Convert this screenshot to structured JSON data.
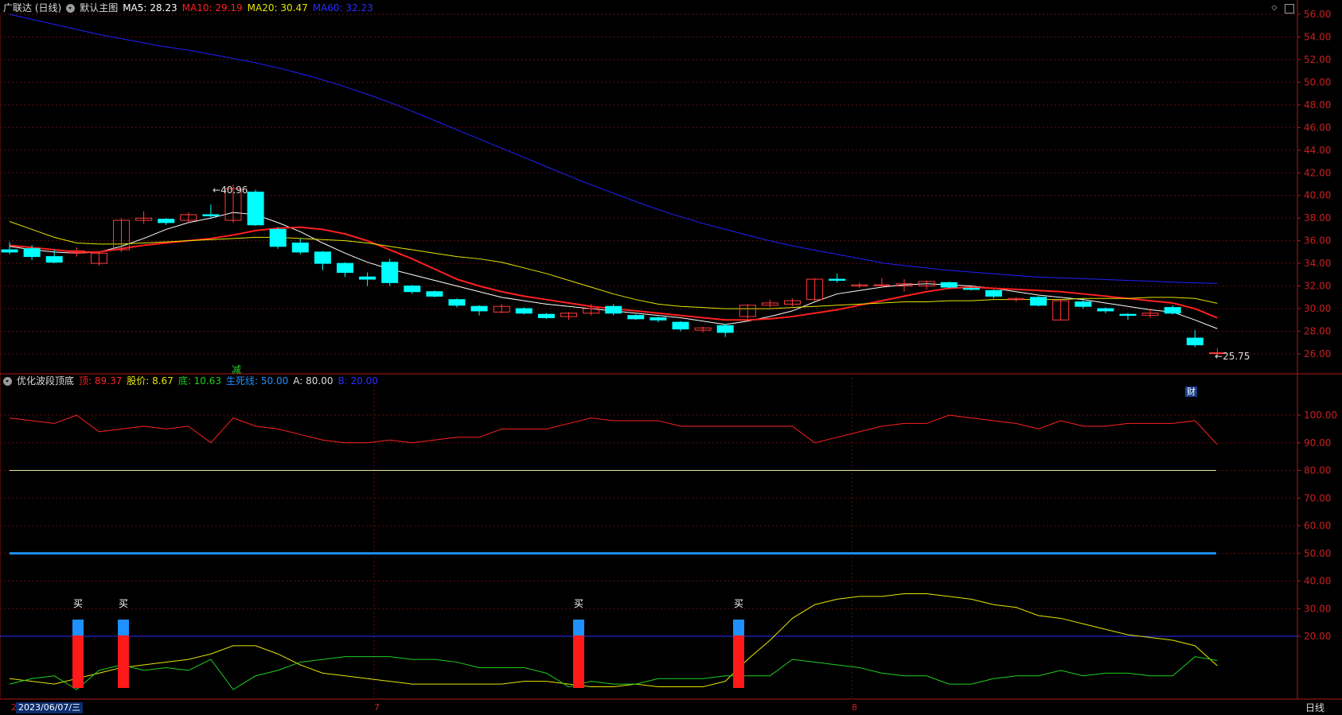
{
  "main_header": {
    "stock_label": "广联达 (日线)",
    "template_label": "默认主图",
    "ma5": "MA5: 28.23",
    "ma10": "MA10: 29.19",
    "ma20": "MA20: 30.47",
    "ma60": "MA60: 32.23"
  },
  "indicator_header": {
    "name": "优化波段顶底",
    "top": "顶: 89.37",
    "price": "股价: 8.67",
    "bottom": "底: 10.63",
    "lifeline": "生死线: 50.00",
    "a": "A: 80.00",
    "b": "B: 20.00"
  },
  "price_axis": [
    "56.00",
    "54.00",
    "52.00",
    "50.00",
    "48.00",
    "46.00",
    "44.00",
    "42.00",
    "40.00",
    "38.00",
    "36.00",
    "34.00",
    "32.00",
    "30.00",
    "28.00",
    "26.00"
  ],
  "indicator_axis": [
    "100.00",
    "90.00",
    "80.00",
    "70.00",
    "60.00",
    "50.00",
    "40.00",
    "30.00",
    "20.00"
  ],
  "annotations": {
    "high_label": "40.96",
    "low_label": "25.75",
    "reduce_tag": "减",
    "finance_tag": "财",
    "buy_signal": "买"
  },
  "bottom_bar": {
    "date": "2023/06/07/三",
    "left_mark": "2",
    "month7": "7",
    "month8": "8",
    "period_button": "日线"
  },
  "colors": {
    "up": "#ff3b3b",
    "down": "#00ffff",
    "ma5": "#ffffff",
    "ma10": "#ff2020",
    "ma20": "#e6e600",
    "ma60": "#2020ff",
    "top_line": "#ff2020",
    "bottom_line": "#20d020",
    "price_line": "#e6e600",
    "lifeline": "#1e90ff"
  },
  "chart_data": [
    {
      "type": "candlestick",
      "title": "广联达 (日线)",
      "ylim": [
        25,
        57
      ],
      "candles": [
        {
          "o": 35.2,
          "h": 35.9,
          "l": 34.8,
          "c": 35.0
        },
        {
          "o": 35.3,
          "h": 35.6,
          "l": 34.3,
          "c": 34.6
        },
        {
          "o": 34.6,
          "h": 35.2,
          "l": 34.0,
          "c": 34.1
        },
        {
          "o": 34.9,
          "h": 35.4,
          "l": 34.6,
          "c": 35.1
        },
        {
          "o": 34.0,
          "h": 35.0,
          "l": 33.8,
          "c": 34.9
        },
        {
          "o": 35.2,
          "h": 38.0,
          "l": 35.0,
          "c": 37.8
        },
        {
          "o": 37.8,
          "h": 38.6,
          "l": 37.5,
          "c": 38.0
        },
        {
          "o": 37.9,
          "h": 38.0,
          "l": 37.4,
          "c": 37.6
        },
        {
          "o": 37.8,
          "h": 38.5,
          "l": 37.6,
          "c": 38.3
        },
        {
          "o": 38.3,
          "h": 39.2,
          "l": 38.0,
          "c": 38.2
        },
        {
          "o": 37.8,
          "h": 40.96,
          "l": 37.6,
          "c": 40.6
        },
        {
          "o": 40.3,
          "h": 40.5,
          "l": 37.3,
          "c": 37.4
        },
        {
          "o": 37.0,
          "h": 37.2,
          "l": 35.3,
          "c": 35.5
        },
        {
          "o": 35.8,
          "h": 36.2,
          "l": 34.8,
          "c": 35.0
        },
        {
          "o": 35.0,
          "h": 35.1,
          "l": 33.4,
          "c": 34.0
        },
        {
          "o": 34.0,
          "h": 34.1,
          "l": 32.8,
          "c": 33.2
        },
        {
          "o": 32.8,
          "h": 33.2,
          "l": 32.0,
          "c": 32.6
        },
        {
          "o": 34.1,
          "h": 34.4,
          "l": 32.0,
          "c": 32.3
        },
        {
          "o": 32.0,
          "h": 32.1,
          "l": 31.3,
          "c": 31.5
        },
        {
          "o": 31.5,
          "h": 31.6,
          "l": 31.0,
          "c": 31.1
        },
        {
          "o": 30.8,
          "h": 30.9,
          "l": 30.1,
          "c": 30.3
        },
        {
          "o": 30.2,
          "h": 30.3,
          "l": 29.4,
          "c": 29.8
        },
        {
          "o": 29.7,
          "h": 30.4,
          "l": 29.6,
          "c": 30.2
        },
        {
          "o": 30.0,
          "h": 30.1,
          "l": 29.5,
          "c": 29.6
        },
        {
          "o": 29.5,
          "h": 29.6,
          "l": 29.1,
          "c": 29.2
        },
        {
          "o": 29.3,
          "h": 29.7,
          "l": 29.0,
          "c": 29.6
        },
        {
          "o": 29.6,
          "h": 30.4,
          "l": 29.4,
          "c": 30.0
        },
        {
          "o": 30.2,
          "h": 30.4,
          "l": 29.4,
          "c": 29.6
        },
        {
          "o": 29.4,
          "h": 29.5,
          "l": 29.0,
          "c": 29.1
        },
        {
          "o": 29.2,
          "h": 29.3,
          "l": 28.8,
          "c": 29.0
        },
        {
          "o": 28.8,
          "h": 28.9,
          "l": 28.0,
          "c": 28.2
        },
        {
          "o": 28.1,
          "h": 28.4,
          "l": 27.9,
          "c": 28.3
        },
        {
          "o": 28.5,
          "h": 28.6,
          "l": 27.5,
          "c": 27.9
        },
        {
          "o": 29.3,
          "h": 30.4,
          "l": 29.0,
          "c": 30.3
        },
        {
          "o": 30.3,
          "h": 30.8,
          "l": 30.1,
          "c": 30.5
        },
        {
          "o": 30.4,
          "h": 30.9,
          "l": 30.2,
          "c": 30.7
        },
        {
          "o": 30.8,
          "h": 32.7,
          "l": 30.7,
          "c": 32.6
        },
        {
          "o": 32.6,
          "h": 33.1,
          "l": 32.3,
          "c": 32.5
        },
        {
          "o": 32.0,
          "h": 32.3,
          "l": 31.8,
          "c": 32.1
        },
        {
          "o": 32.1,
          "h": 32.7,
          "l": 31.9,
          "c": 32.1
        },
        {
          "o": 32.0,
          "h": 32.6,
          "l": 31.5,
          "c": 32.2
        },
        {
          "o": 32.0,
          "h": 32.5,
          "l": 31.7,
          "c": 32.4
        },
        {
          "o": 32.3,
          "h": 32.4,
          "l": 31.8,
          "c": 31.9
        },
        {
          "o": 31.8,
          "h": 31.9,
          "l": 31.6,
          "c": 31.7
        },
        {
          "o": 31.6,
          "h": 31.7,
          "l": 30.9,
          "c": 31.1
        },
        {
          "o": 30.8,
          "h": 31.0,
          "l": 30.6,
          "c": 30.9
        },
        {
          "o": 31.0,
          "h": 31.1,
          "l": 30.2,
          "c": 30.3
        },
        {
          "o": 29.0,
          "h": 30.8,
          "l": 29.0,
          "c": 30.7
        },
        {
          "o": 30.6,
          "h": 30.8,
          "l": 30.0,
          "c": 30.2
        },
        {
          "o": 30.0,
          "h": 30.1,
          "l": 29.6,
          "c": 29.8
        },
        {
          "o": 29.5,
          "h": 29.6,
          "l": 29.0,
          "c": 29.4
        },
        {
          "o": 29.4,
          "h": 30.0,
          "l": 29.2,
          "c": 29.6
        },
        {
          "o": 30.1,
          "h": 30.3,
          "l": 29.5,
          "c": 29.6
        },
        {
          "o": 27.4,
          "h": 28.1,
          "l": 26.6,
          "c": 26.8
        },
        {
          "o": 26.1,
          "h": 26.5,
          "l": 25.75,
          "c": 26.1
        }
      ],
      "series": [
        {
          "name": "MA5",
          "values": [
            35.5,
            35.2,
            35.0,
            34.9,
            35.0,
            35.5,
            36.2,
            37.0,
            37.6,
            38.0,
            38.5,
            38.3,
            37.6,
            36.8,
            35.8,
            34.9,
            34.1,
            33.5,
            33.0,
            32.5,
            32.0,
            31.5,
            31.0,
            30.7,
            30.4,
            30.2,
            30.0,
            29.8,
            29.6,
            29.4,
            29.2,
            28.9,
            28.6,
            28.9,
            29.3,
            29.8,
            30.6,
            31.3,
            31.6,
            31.9,
            32.1,
            32.2,
            32.1,
            32.0,
            31.8,
            31.5,
            31.2,
            31.0,
            30.8,
            30.5,
            30.2,
            29.9,
            29.7,
            29.0,
            28.23
          ]
        },
        {
          "name": "MA10",
          "values": [
            35.6,
            35.4,
            35.2,
            35.0,
            35.0,
            35.3,
            35.6,
            35.8,
            36.0,
            36.2,
            36.5,
            36.9,
            37.1,
            37.2,
            37.0,
            36.6,
            36.0,
            35.2,
            34.4,
            33.5,
            32.6,
            32.0,
            31.5,
            31.1,
            30.8,
            30.5,
            30.2,
            30.0,
            29.8,
            29.6,
            29.4,
            29.2,
            29.0,
            29.0,
            29.1,
            29.3,
            29.6,
            29.9,
            30.3,
            30.7,
            31.1,
            31.5,
            31.8,
            31.9,
            31.8,
            31.7,
            31.6,
            31.5,
            31.3,
            31.1,
            30.9,
            30.7,
            30.5,
            30.0,
            29.19
          ]
        },
        {
          "name": "MA20",
          "values": [
            37.7,
            37.0,
            36.3,
            35.8,
            35.7,
            35.7,
            35.8,
            35.9,
            36.0,
            36.1,
            36.2,
            36.3,
            36.3,
            36.2,
            36.1,
            36.0,
            35.8,
            35.5,
            35.2,
            34.9,
            34.6,
            34.4,
            34.1,
            33.6,
            33.1,
            32.5,
            31.9,
            31.3,
            30.8,
            30.4,
            30.2,
            30.1,
            30.0,
            30.0,
            30.0,
            30.1,
            30.2,
            30.3,
            30.4,
            30.5,
            30.6,
            30.6,
            30.7,
            30.7,
            30.8,
            30.8,
            30.8,
            30.8,
            30.9,
            30.9,
            30.9,
            31.0,
            31.0,
            30.9,
            30.47
          ]
        },
        {
          "name": "MA60",
          "values": [
            56.0,
            55.4,
            54.8,
            54.2,
            53.7,
            53.2,
            52.8,
            52.3,
            51.8,
            51.2,
            50.5,
            49.7,
            48.8,
            47.8,
            46.7,
            45.6,
            44.5,
            43.4,
            42.3,
            41.2,
            40.2,
            39.2,
            38.3,
            37.5,
            36.8,
            36.1,
            35.5,
            35.0,
            34.5,
            34.0,
            33.7,
            33.4,
            33.2,
            33.0,
            32.8,
            32.7,
            32.6,
            32.5,
            32.4,
            32.3,
            32.23
          ]
        }
      ]
    },
    {
      "type": "line",
      "title": "优化波段顶底",
      "ylim": [
        0,
        105
      ],
      "reference_lines": {
        "A": 80,
        "B": 20,
        "lifeline": 50
      },
      "series": [
        {
          "name": "顶",
          "values": [
            99,
            98,
            97,
            100,
            94,
            95,
            96,
            95,
            96,
            90,
            99,
            96,
            95,
            93,
            91,
            90,
            90,
            91,
            90,
            91,
            92,
            92,
            95,
            95,
            95,
            97,
            99,
            98,
            98,
            98,
            96,
            96,
            96,
            96,
            96,
            96,
            90,
            92,
            94,
            96,
            97,
            97,
            100,
            99,
            98,
            97,
            95,
            98,
            96,
            96,
            97,
            97,
            97,
            98,
            89.37
          ]
        },
        {
          "name": "股价",
          "values": [
            4,
            3,
            2,
            4,
            6,
            8,
            9,
            10,
            11,
            13,
            16,
            16,
            13,
            9,
            6,
            5,
            4,
            3,
            2,
            2,
            2,
            2,
            2,
            3,
            3,
            2,
            1,
            1,
            2,
            1,
            1,
            1,
            3,
            11,
            18,
            26,
            31,
            33,
            34,
            34,
            35,
            35,
            34,
            33,
            31,
            30,
            27,
            26,
            24,
            22,
            20,
            19,
            18,
            16,
            8.67
          ]
        },
        {
          "name": "底",
          "values": [
            2,
            4,
            5,
            0,
            7,
            9,
            7,
            8,
            7,
            11,
            0,
            5,
            7,
            10,
            11,
            12,
            12,
            12,
            11,
            11,
            10,
            8,
            8,
            8,
            6,
            1,
            3,
            2,
            2,
            4,
            4,
            4,
            5,
            5,
            5,
            11,
            10,
            9,
            8,
            6,
            5,
            5,
            2,
            2,
            4,
            5,
            5,
            7,
            5,
            6,
            6,
            5,
            5,
            12,
            10.63
          ]
        }
      ],
      "buy_signals_index": [
        3,
        5,
        25,
        32
      ],
      "signal_bar": {
        "blue_top": 22,
        "red_top": 18
      }
    }
  ]
}
